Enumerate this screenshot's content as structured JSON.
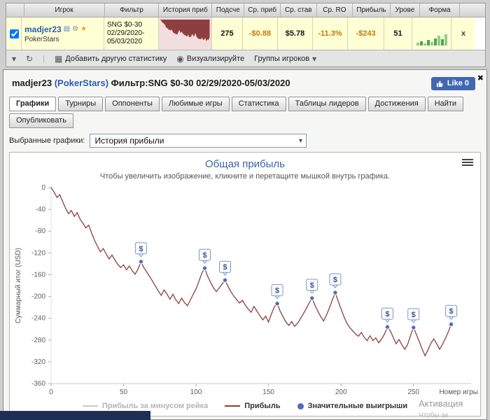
{
  "icons": {
    "dropdown": "▾",
    "refresh": "↻",
    "grid": "▦",
    "eye": "◉",
    "close": "✖",
    "notes": "▤",
    "gear": "⚙",
    "star": "★"
  },
  "top_table": {
    "headers": [
      "Игрок",
      "Фильтр",
      "История приб",
      "Подсче",
      "Ср. приб",
      "Ср. став",
      "Ср. RO",
      "Прибыль",
      "Урове",
      "Форма"
    ],
    "row": {
      "player": "madjer23",
      "site": "PokerStars",
      "filter_lines": [
        "SNG $0-30",
        "02/29/2020-",
        "05/03/2020"
      ],
      "count": "275",
      "avg_profit": "-$0.88",
      "avg_stake": "$5.78",
      "avg_roi": "-11.3%",
      "profit": "-$243",
      "level": "51",
      "remove_label": "x",
      "form_bars": [
        4,
        6,
        3,
        8,
        5,
        10,
        14,
        9,
        16
      ]
    },
    "toolbar": {
      "add_stat": "Добавить другую статистику",
      "visualize": "Визуализируйте",
      "groups": "Группы игроков"
    }
  },
  "panel": {
    "title_player": "madjer23",
    "title_site": "(PokerStars)",
    "title_filter": " Фильтр:SNG $0-30 02/29/2020-05/03/2020",
    "like_label": "Like 0",
    "close_label": "✖",
    "tabs": [
      "Графики",
      "Турниры",
      "Оппоненты",
      "Любимые игры",
      "Статистика",
      "Таблицы лидеров",
      "Достижения",
      "Найти"
    ],
    "tabs_row2": [
      "Опубликовать"
    ],
    "select_label": "Выбранные графики:",
    "select_value": "История прибыли"
  },
  "chart_data": {
    "type": "line",
    "title": "Общая прибыль",
    "subtitle": "Чтобы увеличить изображение, кликните и перетащите мышкой внутрь графика.",
    "ylabel": "Суммарный итог (USD)",
    "xlabel": "Номер игры",
    "xlim": [
      0,
      282
    ],
    "ylim": [
      -360,
      0
    ],
    "yticks": [
      0,
      -40,
      -80,
      -120,
      -160,
      -200,
      -240,
      -280,
      -320,
      -360
    ],
    "xticks": [
      0,
      50,
      100,
      150,
      200,
      250
    ],
    "grid": false,
    "legend_position": "bottom",
    "line_color": "#8d3e3e",
    "marker_color": "#4f6db8",
    "flag_border": "#8093c0",
    "flag_symbol": "$",
    "legend": [
      {
        "label": "Прибыль за минусом рейка",
        "color": "#c9c9c9",
        "type": "line",
        "muted": true
      },
      {
        "label": "Прибыль",
        "color": "#8d3e3e",
        "type": "line",
        "muted": false
      },
      {
        "label": "Значительные выигрыши",
        "color": "#4f6db8",
        "type": "point",
        "muted": false
      }
    ],
    "series": [
      {
        "name": "Прибыль",
        "points": [
          [
            0,
            0
          ],
          [
            2,
            -8
          ],
          [
            4,
            -18
          ],
          [
            6,
            -13
          ],
          [
            8,
            -26
          ],
          [
            10,
            -38
          ],
          [
            12,
            -48
          ],
          [
            14,
            -42
          ],
          [
            16,
            -53
          ],
          [
            18,
            -46
          ],
          [
            20,
            -58
          ],
          [
            22,
            -66
          ],
          [
            24,
            -74
          ],
          [
            26,
            -69
          ],
          [
            28,
            -84
          ],
          [
            30,
            -97
          ],
          [
            32,
            -108
          ],
          [
            34,
            -118
          ],
          [
            36,
            -112
          ],
          [
            38,
            -122
          ],
          [
            40,
            -131
          ],
          [
            42,
            -124
          ],
          [
            44,
            -133
          ],
          [
            46,
            -141
          ],
          [
            48,
            -147
          ],
          [
            50,
            -142
          ],
          [
            52,
            -151
          ],
          [
            54,
            -144
          ],
          [
            56,
            -153
          ],
          [
            58,
            -159
          ],
          [
            60,
            -149
          ],
          [
            62,
            -136
          ],
          [
            64,
            -147
          ],
          [
            66,
            -155
          ],
          [
            68,
            -163
          ],
          [
            70,
            -172
          ],
          [
            72,
            -181
          ],
          [
            74,
            -190
          ],
          [
            76,
            -198
          ],
          [
            78,
            -188
          ],
          [
            80,
            -196
          ],
          [
            82,
            -205
          ],
          [
            84,
            -196
          ],
          [
            86,
            -206
          ],
          [
            88,
            -213
          ],
          [
            90,
            -203
          ],
          [
            92,
            -211
          ],
          [
            94,
            -217
          ],
          [
            96,
            -207
          ],
          [
            98,
            -196
          ],
          [
            100,
            -186
          ],
          [
            102,
            -172
          ],
          [
            104,
            -157
          ],
          [
            106,
            -148
          ],
          [
            108,
            -163
          ],
          [
            110,
            -174
          ],
          [
            112,
            -184
          ],
          [
            114,
            -191
          ],
          [
            116,
            -184
          ],
          [
            118,
            -177
          ],
          [
            120,
            -170
          ],
          [
            122,
            -181
          ],
          [
            124,
            -191
          ],
          [
            126,
            -199
          ],
          [
            128,
            -206
          ],
          [
            130,
            -212
          ],
          [
            132,
            -207
          ],
          [
            134,
            -216
          ],
          [
            136,
            -223
          ],
          [
            138,
            -229
          ],
          [
            140,
            -218
          ],
          [
            142,
            -227
          ],
          [
            144,
            -235
          ],
          [
            146,
            -243
          ],
          [
            148,
            -236
          ],
          [
            150,
            -247
          ],
          [
            152,
            -232
          ],
          [
            154,
            -219
          ],
          [
            156,
            -213
          ],
          [
            158,
            -227
          ],
          [
            160,
            -237
          ],
          [
            162,
            -247
          ],
          [
            164,
            -253
          ],
          [
            166,
            -246
          ],
          [
            168,
            -255
          ],
          [
            170,
            -249
          ],
          [
            172,
            -241
          ],
          [
            174,
            -232
          ],
          [
            176,
            -222
          ],
          [
            178,
            -212
          ],
          [
            180,
            -203
          ],
          [
            182,
            -216
          ],
          [
            184,
            -227
          ],
          [
            186,
            -237
          ],
          [
            188,
            -245
          ],
          [
            190,
            -234
          ],
          [
            192,
            -221
          ],
          [
            194,
            -206
          ],
          [
            196,
            -193
          ],
          [
            198,
            -208
          ],
          [
            200,
            -223
          ],
          [
            202,
            -237
          ],
          [
            204,
            -249
          ],
          [
            206,
            -257
          ],
          [
            208,
            -263
          ],
          [
            210,
            -269
          ],
          [
            212,
            -273
          ],
          [
            214,
            -266
          ],
          [
            216,
            -275
          ],
          [
            218,
            -281
          ],
          [
            220,
            -272
          ],
          [
            222,
            -281
          ],
          [
            224,
            -276
          ],
          [
            226,
            -285
          ],
          [
            228,
            -278
          ],
          [
            230,
            -269
          ],
          [
            232,
            -256
          ],
          [
            234,
            -263
          ],
          [
            236,
            -275
          ],
          [
            238,
            -287
          ],
          [
            240,
            -279
          ],
          [
            242,
            -289
          ],
          [
            244,
            -297
          ],
          [
            246,
            -288
          ],
          [
            248,
            -271
          ],
          [
            250,
            -257
          ],
          [
            252,
            -270
          ],
          [
            254,
            -283
          ],
          [
            256,
            -297
          ],
          [
            258,
            -309
          ],
          [
            260,
            -298
          ],
          [
            262,
            -286
          ],
          [
            264,
            -278
          ],
          [
            266,
            -287
          ],
          [
            268,
            -297
          ],
          [
            270,
            -288
          ],
          [
            272,
            -277
          ],
          [
            274,
            -265
          ],
          [
            276,
            -251
          ]
        ]
      }
    ],
    "win_markers": [
      [
        62,
        -136
      ],
      [
        106,
        -148
      ],
      [
        120,
        -170
      ],
      [
        156,
        -213
      ],
      [
        180,
        -203
      ],
      [
        196,
        -193
      ],
      [
        232,
        -256
      ],
      [
        250,
        -257
      ],
      [
        276,
        -251
      ]
    ]
  },
  "footer": {
    "activation": "Активация",
    "activation_sub": "Чтобы ак"
  }
}
